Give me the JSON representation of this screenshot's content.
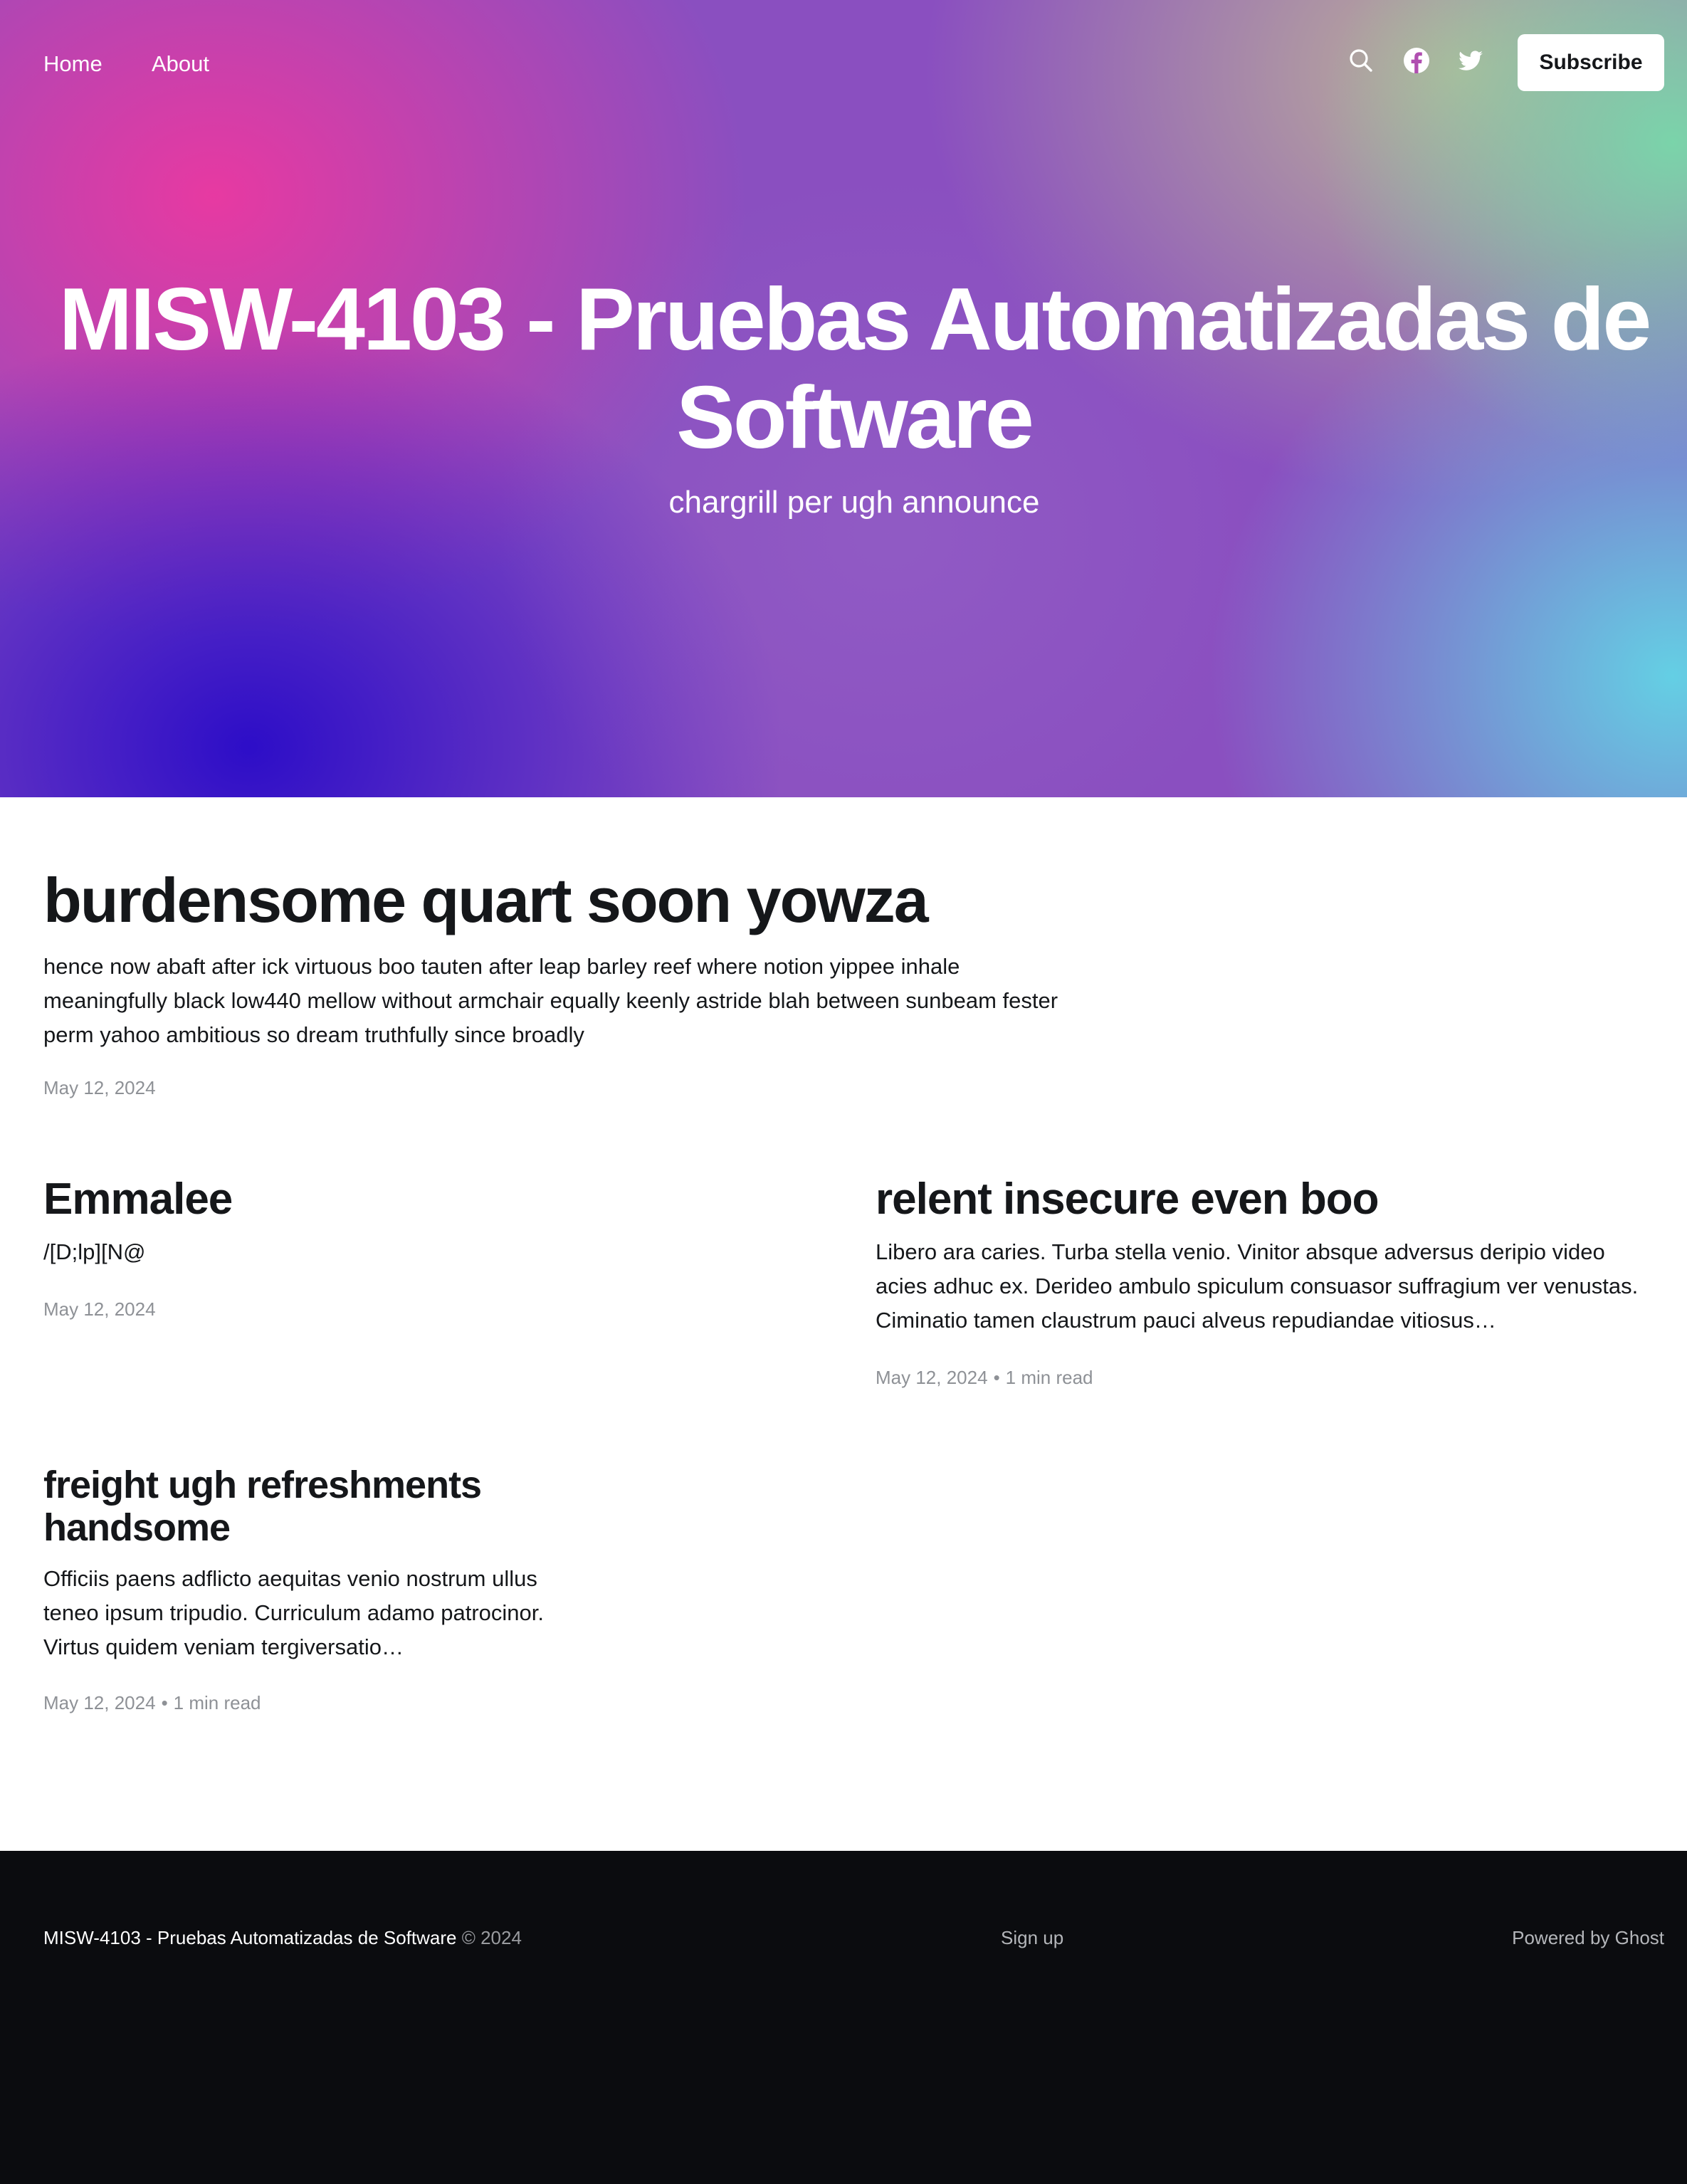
{
  "nav": {
    "home_label": "Home",
    "about_label": "About",
    "icons": [
      "search-icon",
      "facebook-icon",
      "twitter-icon"
    ],
    "subscribe_label": "Subscribe"
  },
  "hero": {
    "title": "MISW-4103 - Pruebas Automatizadas de Software",
    "description": "chargrill per ugh announce",
    "gradient_colors": [
      "#ec3a9f",
      "#bdb696",
      "#78d8aa",
      "#2a0ac8",
      "#62d6e6"
    ]
  },
  "posts": [
    {
      "title": "burdensome quart soon yowza",
      "excerpt": "hence now abaft after ick virtuous boo tauten after leap barley reef where notion yippee inhale meaningfully black low440 mellow without armchair equally keenly astride blah between sunbeam fester perm yahoo ambitious so dream truthfully since broadly",
      "date": "May 12, 2024",
      "reading_time": ""
    },
    {
      "title": "Emmalee",
      "excerpt": "/[D;lp][N@",
      "date": "May 12, 2024",
      "reading_time": ""
    },
    {
      "title": "relent insecure even boo",
      "excerpt": "Libero ara caries. Turba stella venio. Vinitor absque adversus deripio video acies adhuc ex. Derideo ambulo spiculum consuasor suffragium ver venustas. Ciminatio tamen claustrum pauci alveus repudiandae vitiosus…",
      "date": "May 12, 2024",
      "reading_time": "1 min read"
    },
    {
      "title": "freight ugh refreshments handsome",
      "excerpt": "Officiis paens adflicto aequitas venio nostrum ullus teneo ipsum tripudio. Curriculum adamo patrocinor. Virtus quidem veniam tergiversatio…",
      "date": "May 12, 2024",
      "reading_time": "1 min read"
    }
  ],
  "meta_separator": "•",
  "footer": {
    "site_name": "MISW-4103 - Pruebas Automatizadas de Software",
    "copyright": "© 2024",
    "signup_label": "Sign up",
    "powered_by": "Powered by Ghost",
    "background_color": "#0b0c0f"
  }
}
